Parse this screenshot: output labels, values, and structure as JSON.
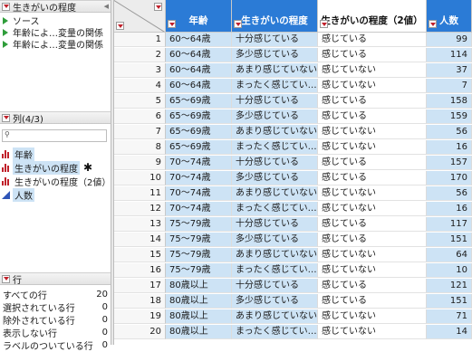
{
  "table_panel": {
    "title": "生きがいの程度",
    "items": [
      "ソース",
      "年齢によ…変量の関係",
      "年齢によ…変量の関係"
    ]
  },
  "columns_panel": {
    "title": "列(4/3)",
    "items": [
      {
        "name": "年齢",
        "type": "nominal",
        "selected": true,
        "starred": false
      },
      {
        "name": "生きがいの程度",
        "type": "nominal",
        "selected": true,
        "starred": true
      },
      {
        "name": "生きがいの程度（2値）",
        "type": "nominal",
        "selected": false,
        "starred": true
      },
      {
        "name": "人数",
        "type": "continuous",
        "selected": true,
        "starred": false
      }
    ]
  },
  "rows_panel": {
    "title": "行",
    "items": [
      {
        "label": "すべての行",
        "value": "20"
      },
      {
        "label": "選択されている行",
        "value": "0"
      },
      {
        "label": "除外されている行",
        "value": "0"
      },
      {
        "label": "表示しない行",
        "value": "0"
      },
      {
        "label": "ラベルのついている行",
        "value": "0"
      }
    ]
  },
  "grid": {
    "headers": [
      "年齢",
      "生きがいの程度",
      "生きがいの程度（2値）",
      "人数"
    ],
    "rows": [
      [
        "1",
        "60～64歳",
        "十分感じている",
        "感じている",
        "99"
      ],
      [
        "2",
        "60～64歳",
        "多少感じている",
        "感じている",
        "114"
      ],
      [
        "3",
        "60～64歳",
        "あまり感じていない",
        "感じていない",
        "37"
      ],
      [
        "4",
        "60～64歳",
        "まったく感じてい…",
        "感じていない",
        "7"
      ],
      [
        "5",
        "65～69歳",
        "十分感じている",
        "感じている",
        "158"
      ],
      [
        "6",
        "65～69歳",
        "多少感じている",
        "感じている",
        "159"
      ],
      [
        "7",
        "65～69歳",
        "あまり感じていない",
        "感じていない",
        "56"
      ],
      [
        "8",
        "65～69歳",
        "まったく感じてい…",
        "感じていない",
        "16"
      ],
      [
        "9",
        "70～74歳",
        "十分感じている",
        "感じている",
        "157"
      ],
      [
        "10",
        "70～74歳",
        "多少感じている",
        "感じている",
        "170"
      ],
      [
        "11",
        "70～74歳",
        "あまり感じていない",
        "感じていない",
        "56"
      ],
      [
        "12",
        "70～74歳",
        "まったく感じてい…",
        "感じていない",
        "16"
      ],
      [
        "13",
        "75～79歳",
        "十分感じている",
        "感じている",
        "117"
      ],
      [
        "14",
        "75～79歳",
        "多少感じている",
        "感じている",
        "151"
      ],
      [
        "15",
        "75～79歳",
        "あまり感じていない",
        "感じていない",
        "64"
      ],
      [
        "16",
        "75～79歳",
        "まったく感じてい…",
        "感じていない",
        "10"
      ],
      [
        "17",
        "80歳以上",
        "十分感じている",
        "感じている",
        "121"
      ],
      [
        "18",
        "80歳以上",
        "多少感じている",
        "感じている",
        "151"
      ],
      [
        "19",
        "80歳以上",
        "あまり感じていない",
        "感じていない",
        "71"
      ],
      [
        "20",
        "80歳以上",
        "まったく感じてい…",
        "感じていない",
        "14"
      ]
    ]
  },
  "colors": {
    "selected_header": "#2b7bd6",
    "selected_cell": "#cde3f5",
    "nominal_icon": "#c0202a",
    "continuous_icon": "#2f55b7",
    "script_icon": "#2f9d3a"
  }
}
